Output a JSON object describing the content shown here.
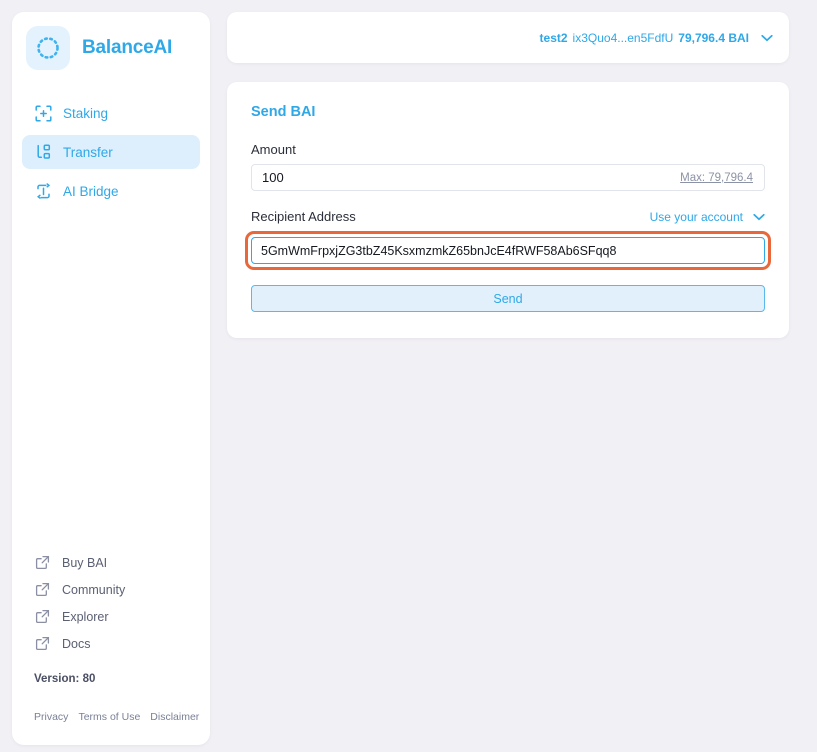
{
  "app": {
    "brand_name": "BalanceAI",
    "logo_icon": "dashed-circle-icon"
  },
  "sidebar": {
    "nav_items": [
      {
        "label": "Staking",
        "icon": "staking-plus-frame-icon",
        "active": false
      },
      {
        "label": "Transfer",
        "icon": "transfer-nodes-icon",
        "active": true
      },
      {
        "label": "AI Bridge",
        "icon": "bridge-refresh-icon",
        "active": false
      }
    ],
    "external_links": [
      {
        "label": "Buy BAI",
        "icon": "external-link-icon"
      },
      {
        "label": "Community",
        "icon": "external-link-icon"
      },
      {
        "label": "Explorer",
        "icon": "external-link-icon"
      },
      {
        "label": "Docs",
        "icon": "external-link-icon"
      }
    ],
    "version": "Version: 80",
    "legal_links": [
      "Privacy",
      "Terms of Use",
      "Disclaimer"
    ]
  },
  "account_bar": {
    "name": "test2",
    "address": "ix3Quo4...en5FdfU",
    "balance": "79,796.4 BAI",
    "chevron_icon": "chevron-down-icon"
  },
  "send_form": {
    "title": "Send BAI",
    "amount_label": "Amount",
    "amount_value": "100",
    "amount_placeholder": "",
    "max_link": "Max: 79,796.4",
    "recipient_label": "Recipient Address",
    "use_account_label": "Use your account",
    "use_account_chevron_icon": "chevron-down-icon",
    "recipient_value": "5GmWmFrpxjZG3tbZ45KsxmzmkZ65bnJcE4fRWF58Ab6SFqq8",
    "recipient_placeholder": "",
    "send_label": "Send"
  },
  "colors": {
    "brand_blue": "#2fa8e8",
    "page_bg": "#f1f0f5",
    "card_bg": "#ffffff",
    "nav_active_bg": "#ddeffc",
    "annotation_ring": "#e8683c",
    "send_btn_bg": "#e2f0fb",
    "muted_text": "#5b6073"
  }
}
